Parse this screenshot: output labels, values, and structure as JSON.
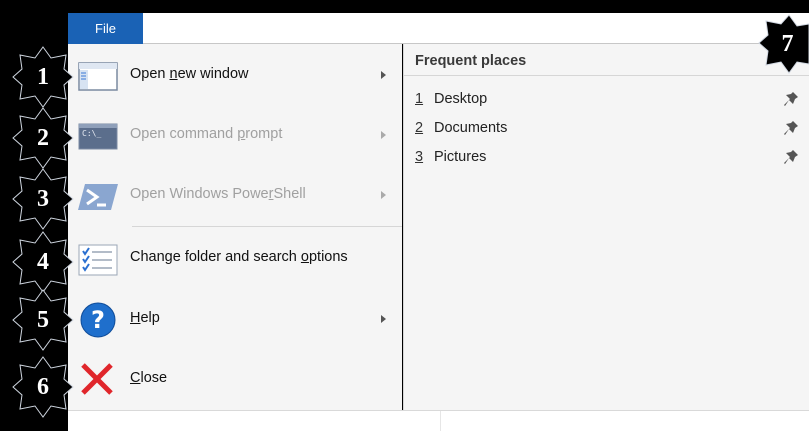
{
  "window": {
    "file_tab": "File"
  },
  "menu": {
    "items": [
      {
        "label_pre": "Open ",
        "label_u": "n",
        "label_post": "ew window",
        "icon": "new-window-icon",
        "disabled": false,
        "submenu": true
      },
      {
        "label_pre": "Open command ",
        "label_u": "p",
        "label_post": "rompt",
        "icon": "command-prompt-icon",
        "icon_text": "C:\\_",
        "disabled": true,
        "submenu": true
      },
      {
        "label_pre": "Open Windows Powe",
        "label_u": "r",
        "label_post": "Shell",
        "icon": "powershell-icon",
        "disabled": true,
        "submenu": true
      },
      {
        "label_pre": "Change folder and search ",
        "label_u": "o",
        "label_post": "ptions",
        "icon": "folder-options-icon",
        "disabled": false,
        "submenu": false
      },
      {
        "label_pre": "",
        "label_u": "H",
        "label_post": "elp",
        "icon": "help-icon",
        "disabled": false,
        "submenu": true
      },
      {
        "label_pre": "",
        "label_u": "C",
        "label_post": "lose",
        "icon": "close-icon",
        "disabled": false,
        "submenu": false
      }
    ]
  },
  "frequent": {
    "title": "Frequent places",
    "places": [
      {
        "num": "1",
        "name": "Desktop"
      },
      {
        "num": "2",
        "name": "Documents"
      },
      {
        "num": "3",
        "name": "Pictures"
      }
    ]
  },
  "callouts": [
    "1",
    "2",
    "3",
    "4",
    "5",
    "6",
    "7"
  ],
  "colors": {
    "accent": "#1a62b5",
    "menu_background": "#f5f5f5",
    "callout": "#000000",
    "close_red": "#e0262b"
  }
}
